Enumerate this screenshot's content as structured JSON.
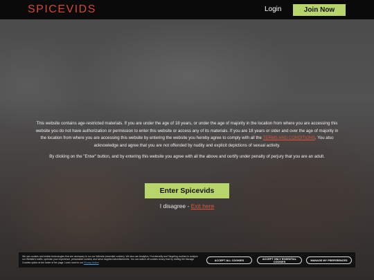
{
  "header": {
    "logo": "SPICEVIDS",
    "login_label": "Login",
    "join_label": "Join Now"
  },
  "disclaimer": {
    "paragraph1_before_link": "This website contains age-restricted materials. If you are under the age of 18 years, or under the age of majority in the location from where you are accessing this website you do not have authorization or permission to enter this website or access any of its materials. If you are 18 years or older and over the age of majority in the location from where you are accessing this website by entering the website you hereby agree to comply with all the",
    "terms_link": "TERMS AND CONDITIONS",
    "paragraph1_after_link": ". You also acknowledge and agree that you are not offended by nudity and explicit depictions of sexual activity.",
    "paragraph2": "By clicking on the \"Enter\" button, and by entering this website you agree with all the above and certify under penalty of perjury that you are an adult."
  },
  "enter_button": "Enter Spicevids",
  "disagree": {
    "text": "I disagree - ",
    "exit_link": "Exit here"
  },
  "cookie_banner": {
    "text": "We use cookies and similar technologies that are necessary to run our Website (essential cookies). We also use Analytics, Functionality and Targeting cookies to analyze our Website's traffic, optimize your experience, personalize content, and serve targeted advertisements. You can switch off cookies at any time by visiting the Manage Cookies option at the footer of the page. Learn more in our",
    "policy_link": "Privacy Notice",
    "accept_all": "ACCEPT ALL COOKIES",
    "accept_essential": "ACCEPT ONLY ESSENTIAL COOKIES",
    "manage": "MANAGE MY PREFERENCES"
  },
  "colors": {
    "accent_green": "#b7d56a",
    "brand_red": "#d3483a",
    "link_red": "#e0533f"
  }
}
